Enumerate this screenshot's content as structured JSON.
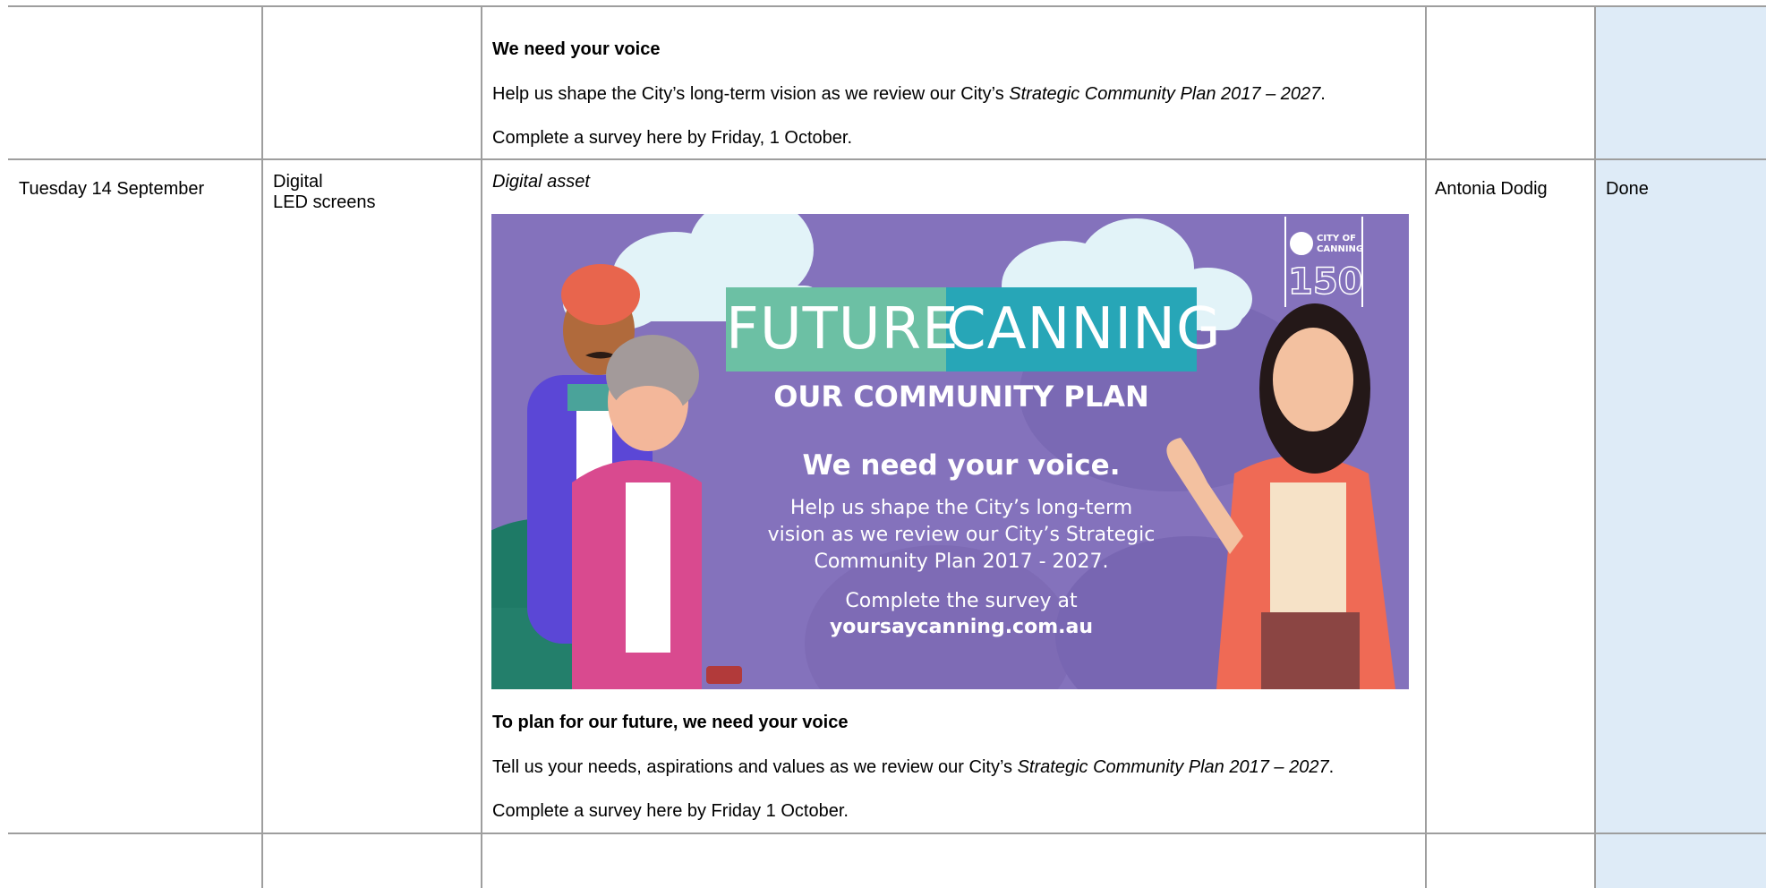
{
  "rows": [
    {
      "date": "",
      "channel": [],
      "content": {
        "label": "",
        "heading": "We need your voice",
        "body_pre": "Help us shape the City’s long-term vision as we review our City’s ",
        "body_italic": "Strategic Community Plan 2017 – 2027",
        "body_post": ".",
        "cta": "Complete a survey here by Friday, 1 October."
      },
      "owner": "",
      "status": ""
    },
    {
      "date": "Tuesday 14 September",
      "channel": [
        "Digital",
        "LED screens"
      ],
      "content": {
        "label": "Digital asset",
        "heading": "To plan for our future, we need your voice",
        "body_pre": "Tell us your needs, aspirations and values as we review our City’s ",
        "body_italic": "Strategic Community Plan 2017 – 2027",
        "body_post": ".",
        "cta": "Complete a survey here by Friday 1 October."
      },
      "owner": "Antonia Dodig",
      "status": "Done"
    }
  ],
  "banner": {
    "title_left": "FUTURE",
    "title_right": "CANNING",
    "subtitle": "OUR COMMUNITY PLAN",
    "headline": "We need your voice.",
    "body_lines": [
      "Help us shape the City’s long-term",
      "vision as we review our City’s Strategic",
      "Community Plan 2017 - 2027."
    ],
    "cta_line": "Complete the survey at",
    "url": "yoursaycanning.com.au",
    "logo_text": [
      "CITY OF",
      "CANNING"
    ],
    "logo_number": "150",
    "colors": {
      "background": "#8472bc",
      "title_left_bg": "#6cc0a4",
      "title_right_bg": "#27a6b7",
      "status_column": "#deebf7"
    }
  }
}
